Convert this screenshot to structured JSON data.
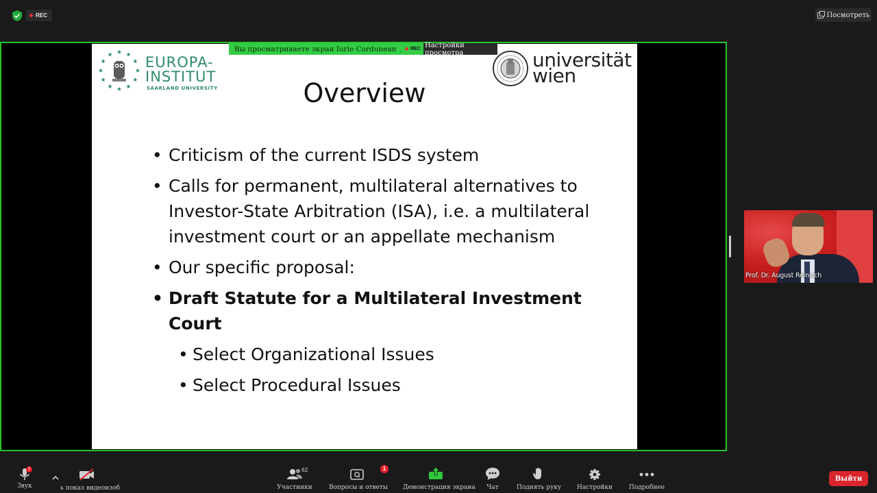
{
  "topbar": {
    "rec_label": "REC",
    "view_button": "Посмотреть"
  },
  "share": {
    "banner_text": "Вы просматриваете экран Iurie Cordunean",
    "banner_rec": "REC",
    "settings_text": "Настройки просмотра"
  },
  "slide": {
    "logo_left_line1": "EUROPA-",
    "logo_left_line2": "INSTITUT",
    "logo_left_line3": "SAARLAND UNIVERSITY",
    "logo_right_line1": "universität",
    "logo_right_line2": "wien",
    "title": "Overview",
    "bullets": [
      {
        "text": "Criticism of the current ISDS system",
        "bold": false,
        "sub": false
      },
      {
        "text": "Calls for permanent, multilateral alternatives to Investor-State Arbitration (ISA), i.e. a multilateral investment court or an appellate mechanism",
        "bold": false,
        "sub": false
      },
      {
        "text": "Our specific proposal:",
        "bold": false,
        "sub": false
      },
      {
        "text": "Draft Statute for a Multilateral Investment Court",
        "bold": true,
        "sub": false
      },
      {
        "text": "Select Organizational Issues",
        "bold": false,
        "sub": true
      },
      {
        "text": "Select Procedural Issues",
        "bold": false,
        "sub": true
      }
    ],
    "bullet_glyph": "•"
  },
  "video": {
    "participant_name": "Prof. Dr. August Reinisch"
  },
  "toolbar": {
    "audio_label": "Звук",
    "video_label": "ь показ видеоизоб",
    "participants_label": "Участники",
    "participants_count": "62",
    "qa_label": "Вопросы и ответы",
    "qa_badge": "1",
    "share_label": "Демонстрация экрана",
    "chat_label": "Чат",
    "raise_hand_label": "Поднять руку",
    "settings_label": "Настройки",
    "more_label": "Подробнее",
    "exit_label": "Выйти"
  },
  "colors": {
    "share_border": "#27c42b",
    "banner_green": "#33cc44",
    "logo_green": "#2e8b6a",
    "exit_red": "#d9262c"
  }
}
